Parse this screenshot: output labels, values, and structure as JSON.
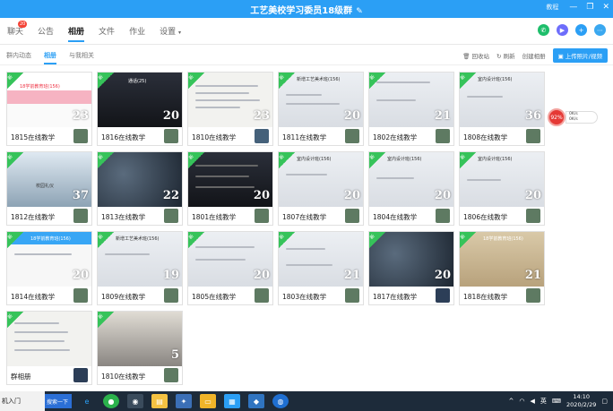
{
  "window": {
    "title": "工艺美校学习委员18级群",
    "edit_icon": "pencil-icon",
    "more_label": "教程"
  },
  "top_tabs": [
    {
      "label": "聊天",
      "badge": "20"
    },
    {
      "label": "公告"
    },
    {
      "label": "相册"
    },
    {
      "label": "文件"
    },
    {
      "label": "作业"
    },
    {
      "label": "设置"
    }
  ],
  "sub_tabs": [
    "群内动态",
    "相册",
    "与我相关"
  ],
  "sub_actions": {
    "recycle": "回收站",
    "refresh": "刷新",
    "create": "创建相册",
    "upload": "上传照片/视频"
  },
  "albums": [
    {
      "name": "1815在线教学",
      "count": "23",
      "thumb_text": "18学前教育班(156)"
    },
    {
      "name": "1816在线教学",
      "count": "20",
      "thumb_text": "通话(25)"
    },
    {
      "name": "1810在线教学",
      "count": "23",
      "thumb_text": ""
    },
    {
      "name": "1811在线教学",
      "count": "20",
      "thumb_text": "新增工艺美术班(156)"
    },
    {
      "name": "1802在线教学",
      "count": "21",
      "thumb_text": ""
    },
    {
      "name": "1808在线教学",
      "count": "36",
      "thumb_text": "室内设计班(156)"
    },
    {
      "name": "1812在线教学",
      "count": "37",
      "thumb_text": "校园礼仪"
    },
    {
      "name": "1813在线教学",
      "count": "22",
      "thumb_text": ""
    },
    {
      "name": "1801在线教学",
      "count": "20",
      "thumb_text": ""
    },
    {
      "name": "1807在线教学",
      "count": "20",
      "thumb_text": "室内设计班(156)"
    },
    {
      "name": "1804在线教学",
      "count": "20",
      "thumb_text": "室内设计班(156)"
    },
    {
      "name": "1806在线教学",
      "count": "20",
      "thumb_text": "室内设计班(156)"
    },
    {
      "name": "1814在线教学",
      "count": "20",
      "thumb_text": "18学前教育班(156)"
    },
    {
      "name": "1809在线教学",
      "count": "19",
      "thumb_text": "新增工艺美术班(156)"
    },
    {
      "name": "1805在线教学",
      "count": "20",
      "thumb_text": ""
    },
    {
      "name": "1803在线教学",
      "count": "21",
      "thumb_text": ""
    },
    {
      "name": "1817在线教学",
      "count": "20",
      "thumb_text": ""
    },
    {
      "name": "1818在线教学",
      "count": "21",
      "thumb_text": "18学前教育班(156)"
    },
    {
      "name": "群相册",
      "count": "",
      "thumb_text": ""
    },
    {
      "name": "1810在线教学",
      "count": "5",
      "thumb_text": ""
    }
  ],
  "new_tag": "新",
  "speed_widget": {
    "percent": "92%",
    "up": "0K/s",
    "down": "0K/s"
  },
  "taskbar": {
    "input_text": "机入门",
    "search_label": "搜索一下",
    "lang": "英",
    "time": "14:10",
    "date": "2020/2/29"
  }
}
